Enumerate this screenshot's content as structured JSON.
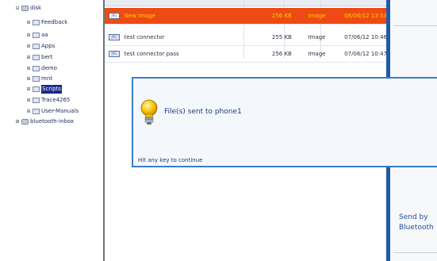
{
  "tree": {
    "items": [
      {
        "label": "disk",
        "expander": "⊟",
        "kind": "drive",
        "selected": false
      },
      {
        "label": "Feedback",
        "expander": "⊞",
        "kind": "folder",
        "selected": false
      },
      {
        "label": "aa",
        "expander": "⊞",
        "kind": "folder",
        "selected": false
      },
      {
        "label": "Apps",
        "expander": "⊞",
        "kind": "folder",
        "selected": false
      },
      {
        "label": "bert",
        "expander": "⊞",
        "kind": "folder",
        "selected": false
      },
      {
        "label": "demo",
        "expander": "⊞",
        "kind": "folder",
        "selected": false
      },
      {
        "label": "mnt",
        "expander": "⊞",
        "kind": "folder",
        "selected": false
      },
      {
        "label": "Scripts",
        "expander": "⊞",
        "kind": "folder",
        "selected": true
      },
      {
        "label": "Trace4265",
        "expander": "⊞",
        "kind": "folder",
        "selected": false
      },
      {
        "label": "User-Manuals",
        "expander": "⊞",
        "kind": "folder",
        "selected": false
      },
      {
        "label": "bluetooth-inbox",
        "expander": "⊞",
        "kind": "drive",
        "selected": false
      }
    ]
  },
  "files": {
    "rows": [
      {
        "name": "New image",
        "size": "256 KB",
        "type": "Image",
        "date": "08/06/12 13:53",
        "selected": true
      },
      {
        "name": "test connector",
        "size": "255 KB",
        "type": "Image",
        "date": "07/06/12 10:46",
        "selected": false
      },
      {
        "name": "test connector pass",
        "size": "256 KB",
        "type": "Image",
        "date": "07/06/12 10:47",
        "selected": false
      }
    ],
    "icon_text": "JPG"
  },
  "dialog": {
    "message": "File(s) sent to phone1",
    "hint": "Hit any key to continue",
    "icon": "lightbulb-icon"
  },
  "side_panel": {
    "send_line1": "Send by",
    "send_line2": "Bluetooth"
  },
  "colors": {
    "selection_bg": "#ee4b14",
    "selection_text": "#f6d000",
    "accent_blue": "#1e5aa8",
    "tree_selection": "#1c2a8c"
  }
}
